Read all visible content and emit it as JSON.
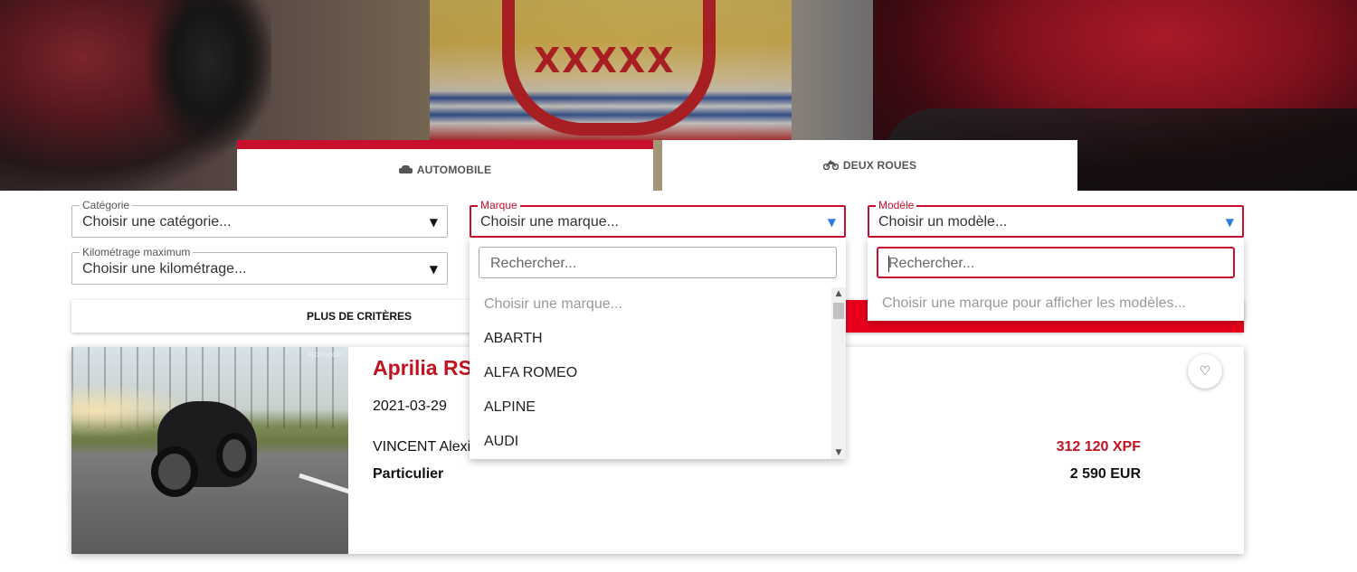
{
  "tabs": {
    "automobile": {
      "label": "AUTOMOBILE",
      "icon": "car-icon"
    },
    "deux_roues": {
      "label": "DEUX ROUES",
      "icon": "motorcycle-icon"
    }
  },
  "filters": {
    "categorie": {
      "label": "Catégorie",
      "value": "Choisir une catégorie..."
    },
    "kilometrage": {
      "label": "Kilométrage maximum",
      "value": "Choisir une kilométrage..."
    },
    "marque": {
      "label": "Marque",
      "value": "Choisir une marque..."
    },
    "modele": {
      "label": "Modèle",
      "value": "Choisir un modèle..."
    }
  },
  "marque_dropdown": {
    "search_placeholder": "Rechercher...",
    "items": [
      "Choisir une marque...",
      "ABARTH",
      "ALFA ROMEO",
      "ALPINE",
      "AUDI"
    ]
  },
  "modele_dropdown": {
    "search_placeholder": "Rechercher...",
    "message": "Choisir une marque pour afficher les modèles..."
  },
  "buttons": {
    "more_criteria": "PLUS DE CRITÈRES"
  },
  "listing": {
    "title": "Aprilia RS",
    "date": "2021-03-29",
    "seller": "VINCENT Alexis",
    "seller_type": "Particulier",
    "price_xpf": "312 120 XPF",
    "price_eur": "2 590 EUR",
    "photo_watermark": "leboncoin"
  },
  "colors": {
    "accent": "#c8102e",
    "search_button": "#e8001c",
    "select_arrow_active": "#2e7be0"
  }
}
